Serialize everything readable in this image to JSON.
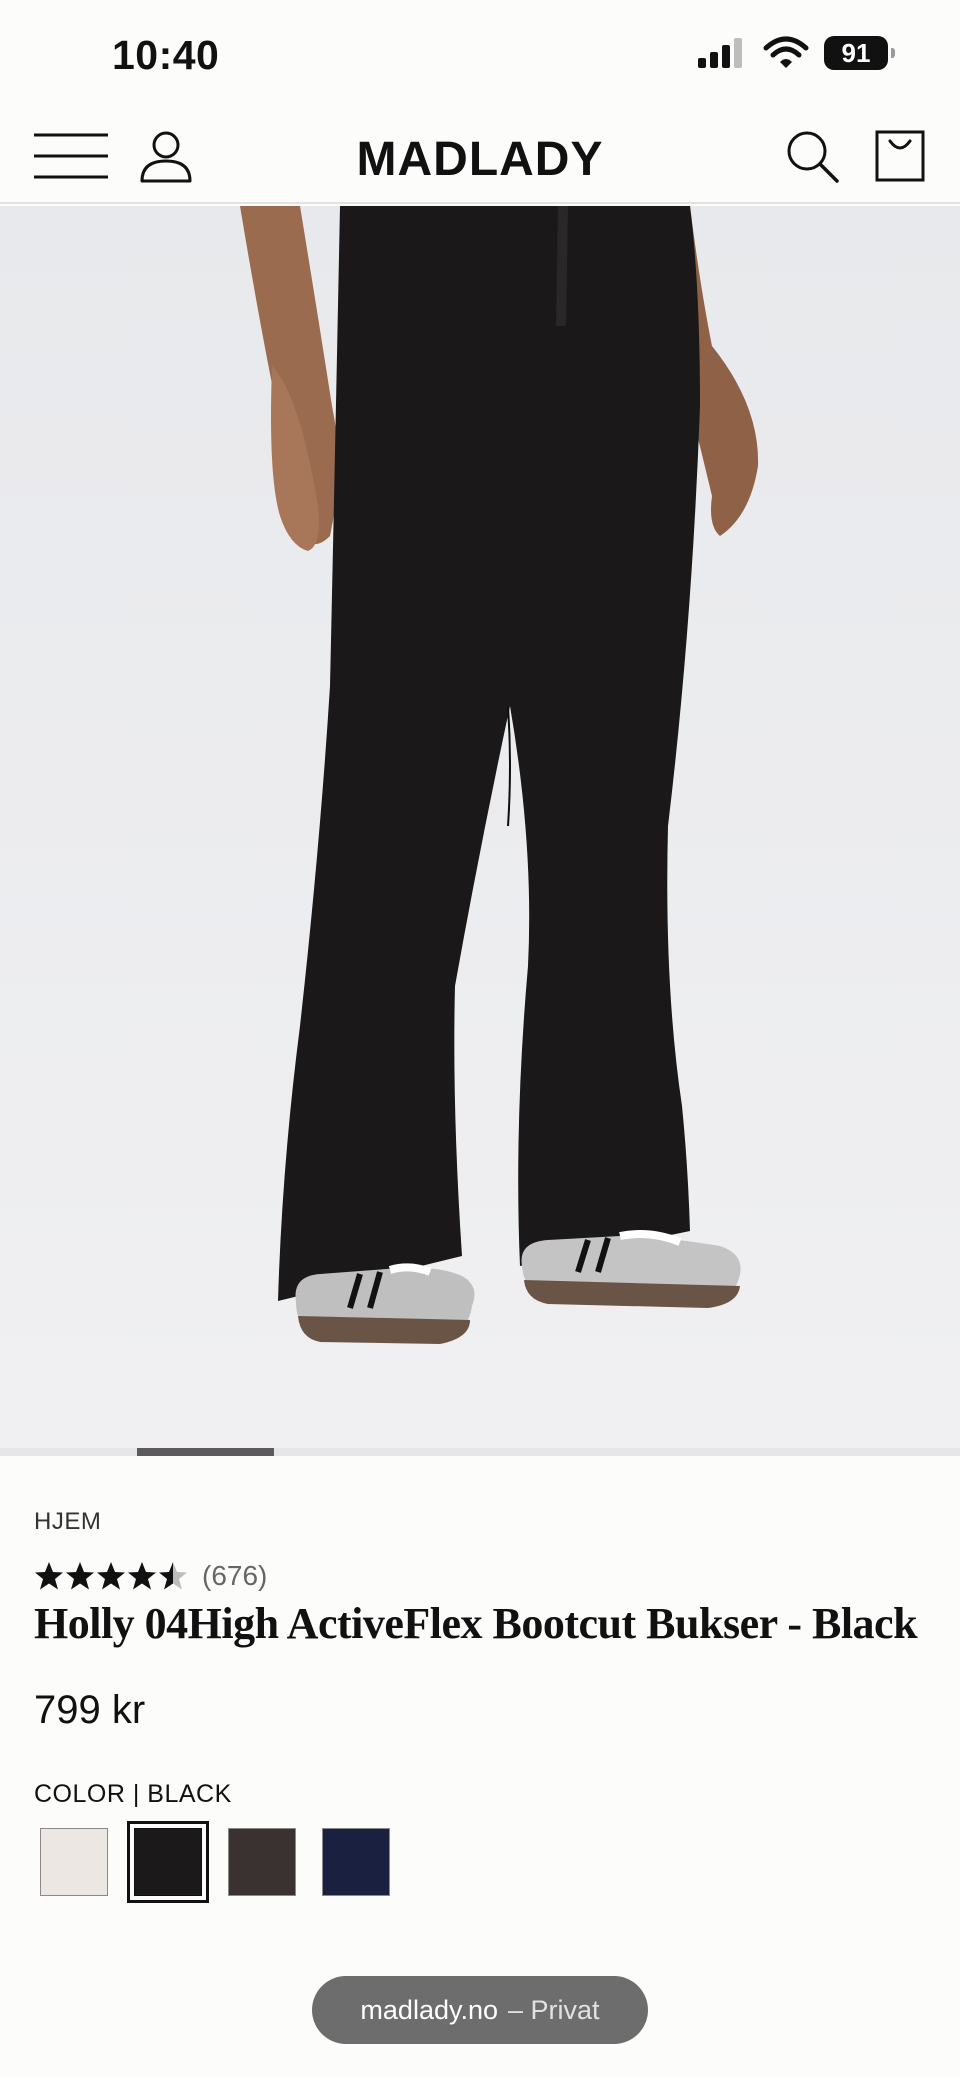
{
  "status_bar": {
    "time": "10:40",
    "battery": "91"
  },
  "header": {
    "logo": "MADLADY"
  },
  "carousel": {
    "current_index": 1,
    "total": 7
  },
  "product": {
    "breadcrumb": "HJEM",
    "rating": {
      "stars": 4.5,
      "count": "(676)"
    },
    "title": "Holly 04High ActiveFlex Bootcut Bukser - Black",
    "price": "799 kr",
    "color_label": "COLOR | BLACK",
    "swatches": [
      {
        "name": "cream",
        "color": "#ede7e3",
        "selected": false
      },
      {
        "name": "black",
        "color": "#1c191b",
        "selected": true
      },
      {
        "name": "brown",
        "color": "#3a3231",
        "selected": false
      },
      {
        "name": "navy",
        "color": "#1a2140",
        "selected": false
      }
    ]
  },
  "browser": {
    "domain": "madlady.no",
    "mode": "– Privat"
  }
}
